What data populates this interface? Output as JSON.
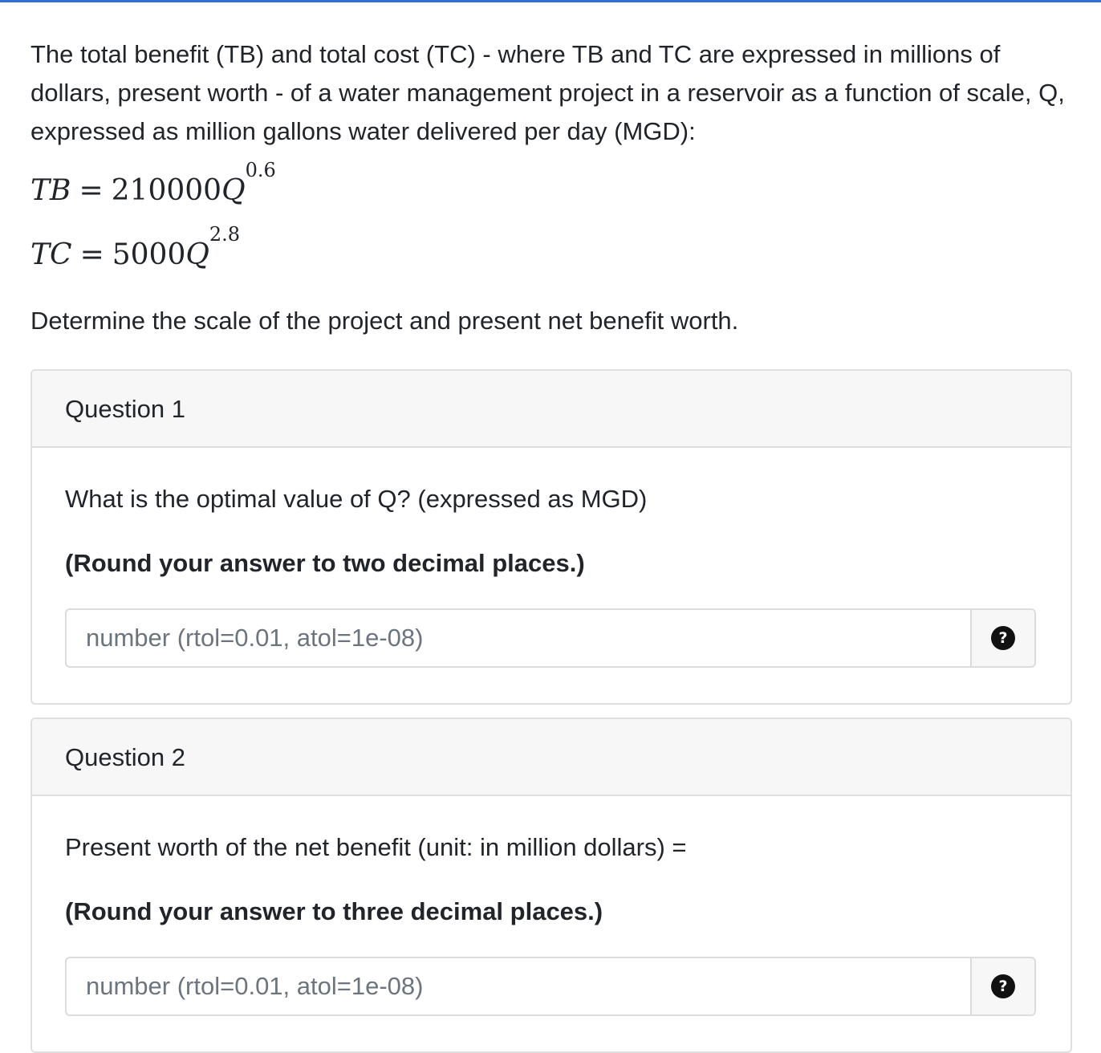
{
  "intro": "The total benefit (TB) and total cost (TC) - where TB and TC are expressed in millions of dollars, present worth - of a water management project in a reservoir as a function of scale, Q, expressed as million gallons water delivered per day (MGD):",
  "equations": [
    {
      "lhs": "TB",
      "op": "=",
      "coef": "210000",
      "var": "Q",
      "exp": "0.6"
    },
    {
      "lhs": "TC",
      "op": "=",
      "coef": "5000",
      "var": "Q",
      "exp": "2.8"
    }
  ],
  "prompt": "Determine the scale of the project and present net benefit worth.",
  "questions": [
    {
      "title": "Question 1",
      "text": "What is the optimal value of Q? (expressed as MGD)",
      "note": "(Round your answer to two decimal places.)",
      "input_value": "",
      "placeholder": "number (rtol=0.01, atol=1e-08)",
      "help_icon": "?"
    },
    {
      "title": "Question 2",
      "text": "Present worth of the net benefit (unit: in million dollars) =",
      "note": "(Round your answer to three decimal places.)",
      "input_value": "",
      "placeholder": "number (rtol=0.01, atol=1e-08)",
      "help_icon": "?"
    }
  ],
  "colors": {
    "accent": "#2f6fdb",
    "card_header_bg": "#f7f7f7",
    "border": "#dfdfdf",
    "text": "#212529",
    "placeholder": "#6c757d"
  }
}
